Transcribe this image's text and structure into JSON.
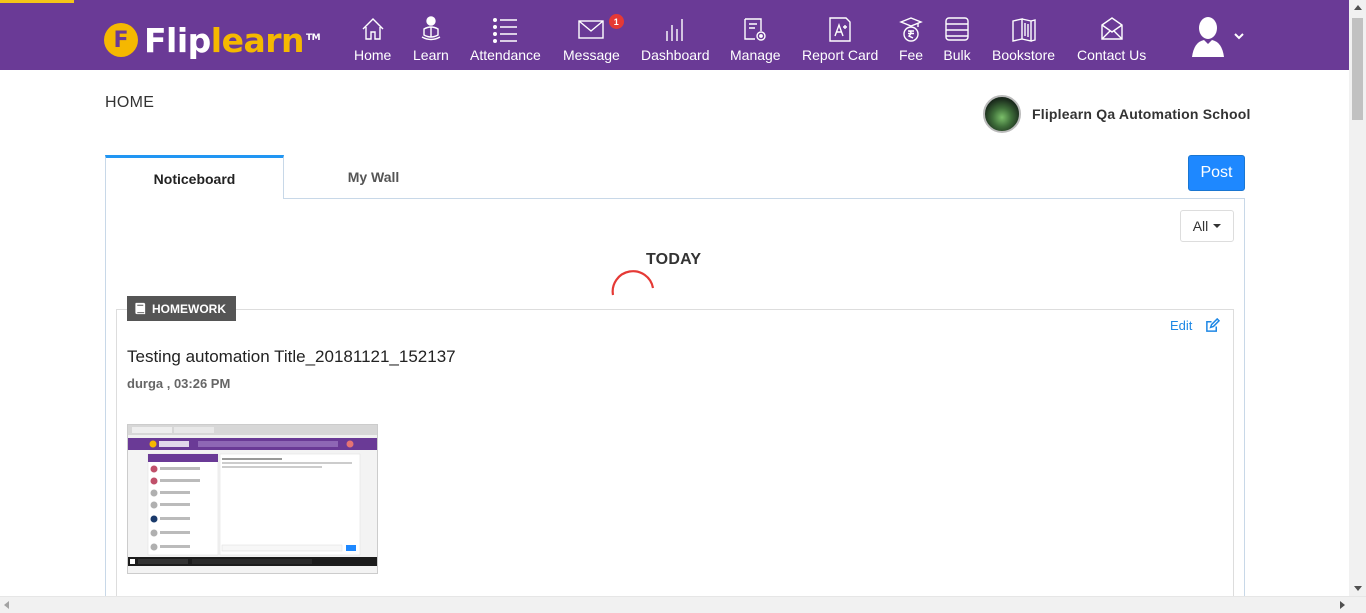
{
  "brand": {
    "logo_letter": "F",
    "name_white": "Flip",
    "name_yellow": "learn",
    "tm": "TM"
  },
  "nav": {
    "items": [
      {
        "label": "Home",
        "icon": "home-icon"
      },
      {
        "label": "Learn",
        "icon": "learn-icon"
      },
      {
        "label": "Attendance",
        "icon": "attendance-icon"
      },
      {
        "label": "Message",
        "icon": "message-icon",
        "badge": "1"
      },
      {
        "label": "Dashboard",
        "icon": "dashboard-icon"
      },
      {
        "label": "Manage",
        "icon": "manage-icon"
      },
      {
        "label": "Report Card",
        "icon": "report-card-icon"
      },
      {
        "label": "Fee",
        "icon": "fee-icon"
      },
      {
        "label": "Bulk",
        "icon": "bulk-icon"
      },
      {
        "label": "Bookstore",
        "icon": "bookstore-icon"
      },
      {
        "label": "Contact Us",
        "icon": "contact-us-icon"
      }
    ]
  },
  "colors": {
    "nav_bg": "#6a3a96",
    "accent_yellow": "#f5b800",
    "primary_blue": "#1e88ff",
    "badge_red": "#e53935"
  },
  "page": {
    "title": "HOME",
    "school_name": "Fliplearn Qa Automation School"
  },
  "tabs": [
    {
      "label": "Noticeboard",
      "active": true
    },
    {
      "label": "My Wall",
      "active": false
    }
  ],
  "post_button": "Post",
  "filter": {
    "selected": "All"
  },
  "feed": {
    "section_label": "TODAY",
    "card": {
      "tag": "HOMEWORK",
      "edit_label": "Edit",
      "title": "Testing automation Title_20181121_152137",
      "meta": "durga , 03:26 PM",
      "attachment": "screenshot-thumbnail"
    }
  }
}
